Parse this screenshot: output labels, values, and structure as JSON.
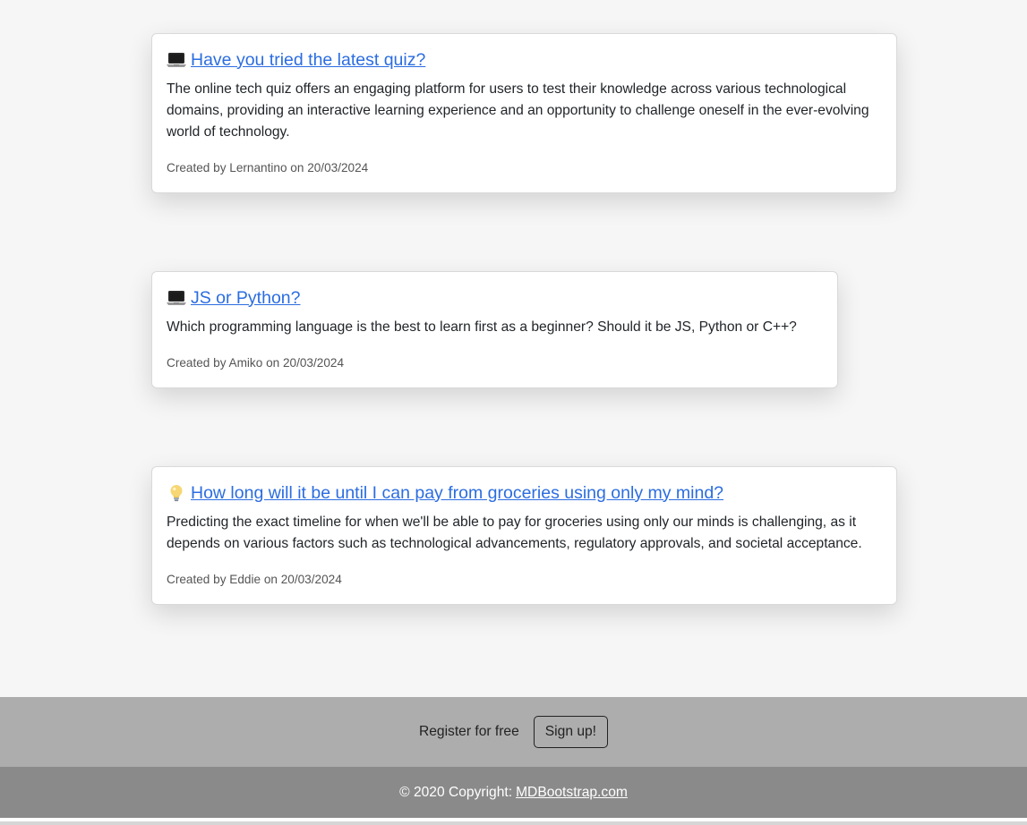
{
  "posts": [
    {
      "icon": "laptop-icon",
      "title": "Have you tried the latest quiz?",
      "body": "The online tech quiz offers an engaging platform for users to test their knowledge across various technological domains, providing an interactive learning experience and an opportunity to challenge oneself in the ever-evolving world of technology.",
      "meta": "Created by Lernantino on 20/03/2024"
    },
    {
      "icon": "laptop-icon",
      "title": "JS or Python?",
      "body": "Which programming language is the best to learn first as a beginner? Should it be JS, Python or C++?",
      "meta": "Created by Amiko on 20/03/2024"
    },
    {
      "icon": "lightbulb-icon",
      "title": "How long will it be until I can pay from groceries using only my mind?",
      "body": "Predicting the exact timeline for when we'll be able to pay for groceries using only our minds is challenging, as it depends on various factors such as technological advancements, regulatory approvals, and societal acceptance.",
      "meta": "Created by Eddie on 20/03/2024"
    }
  ],
  "footer": {
    "register_text": "Register for free",
    "signup_label": "Sign up!",
    "copyright_prefix": "© 2020 Copyright:",
    "copyright_link": "MDBootstrap.com"
  },
  "colors": {
    "link": "#2b6de0",
    "signup_bar": "#adadad",
    "copyright_bar": "#8a8a8a",
    "page_bg": "#f6f6f6"
  }
}
